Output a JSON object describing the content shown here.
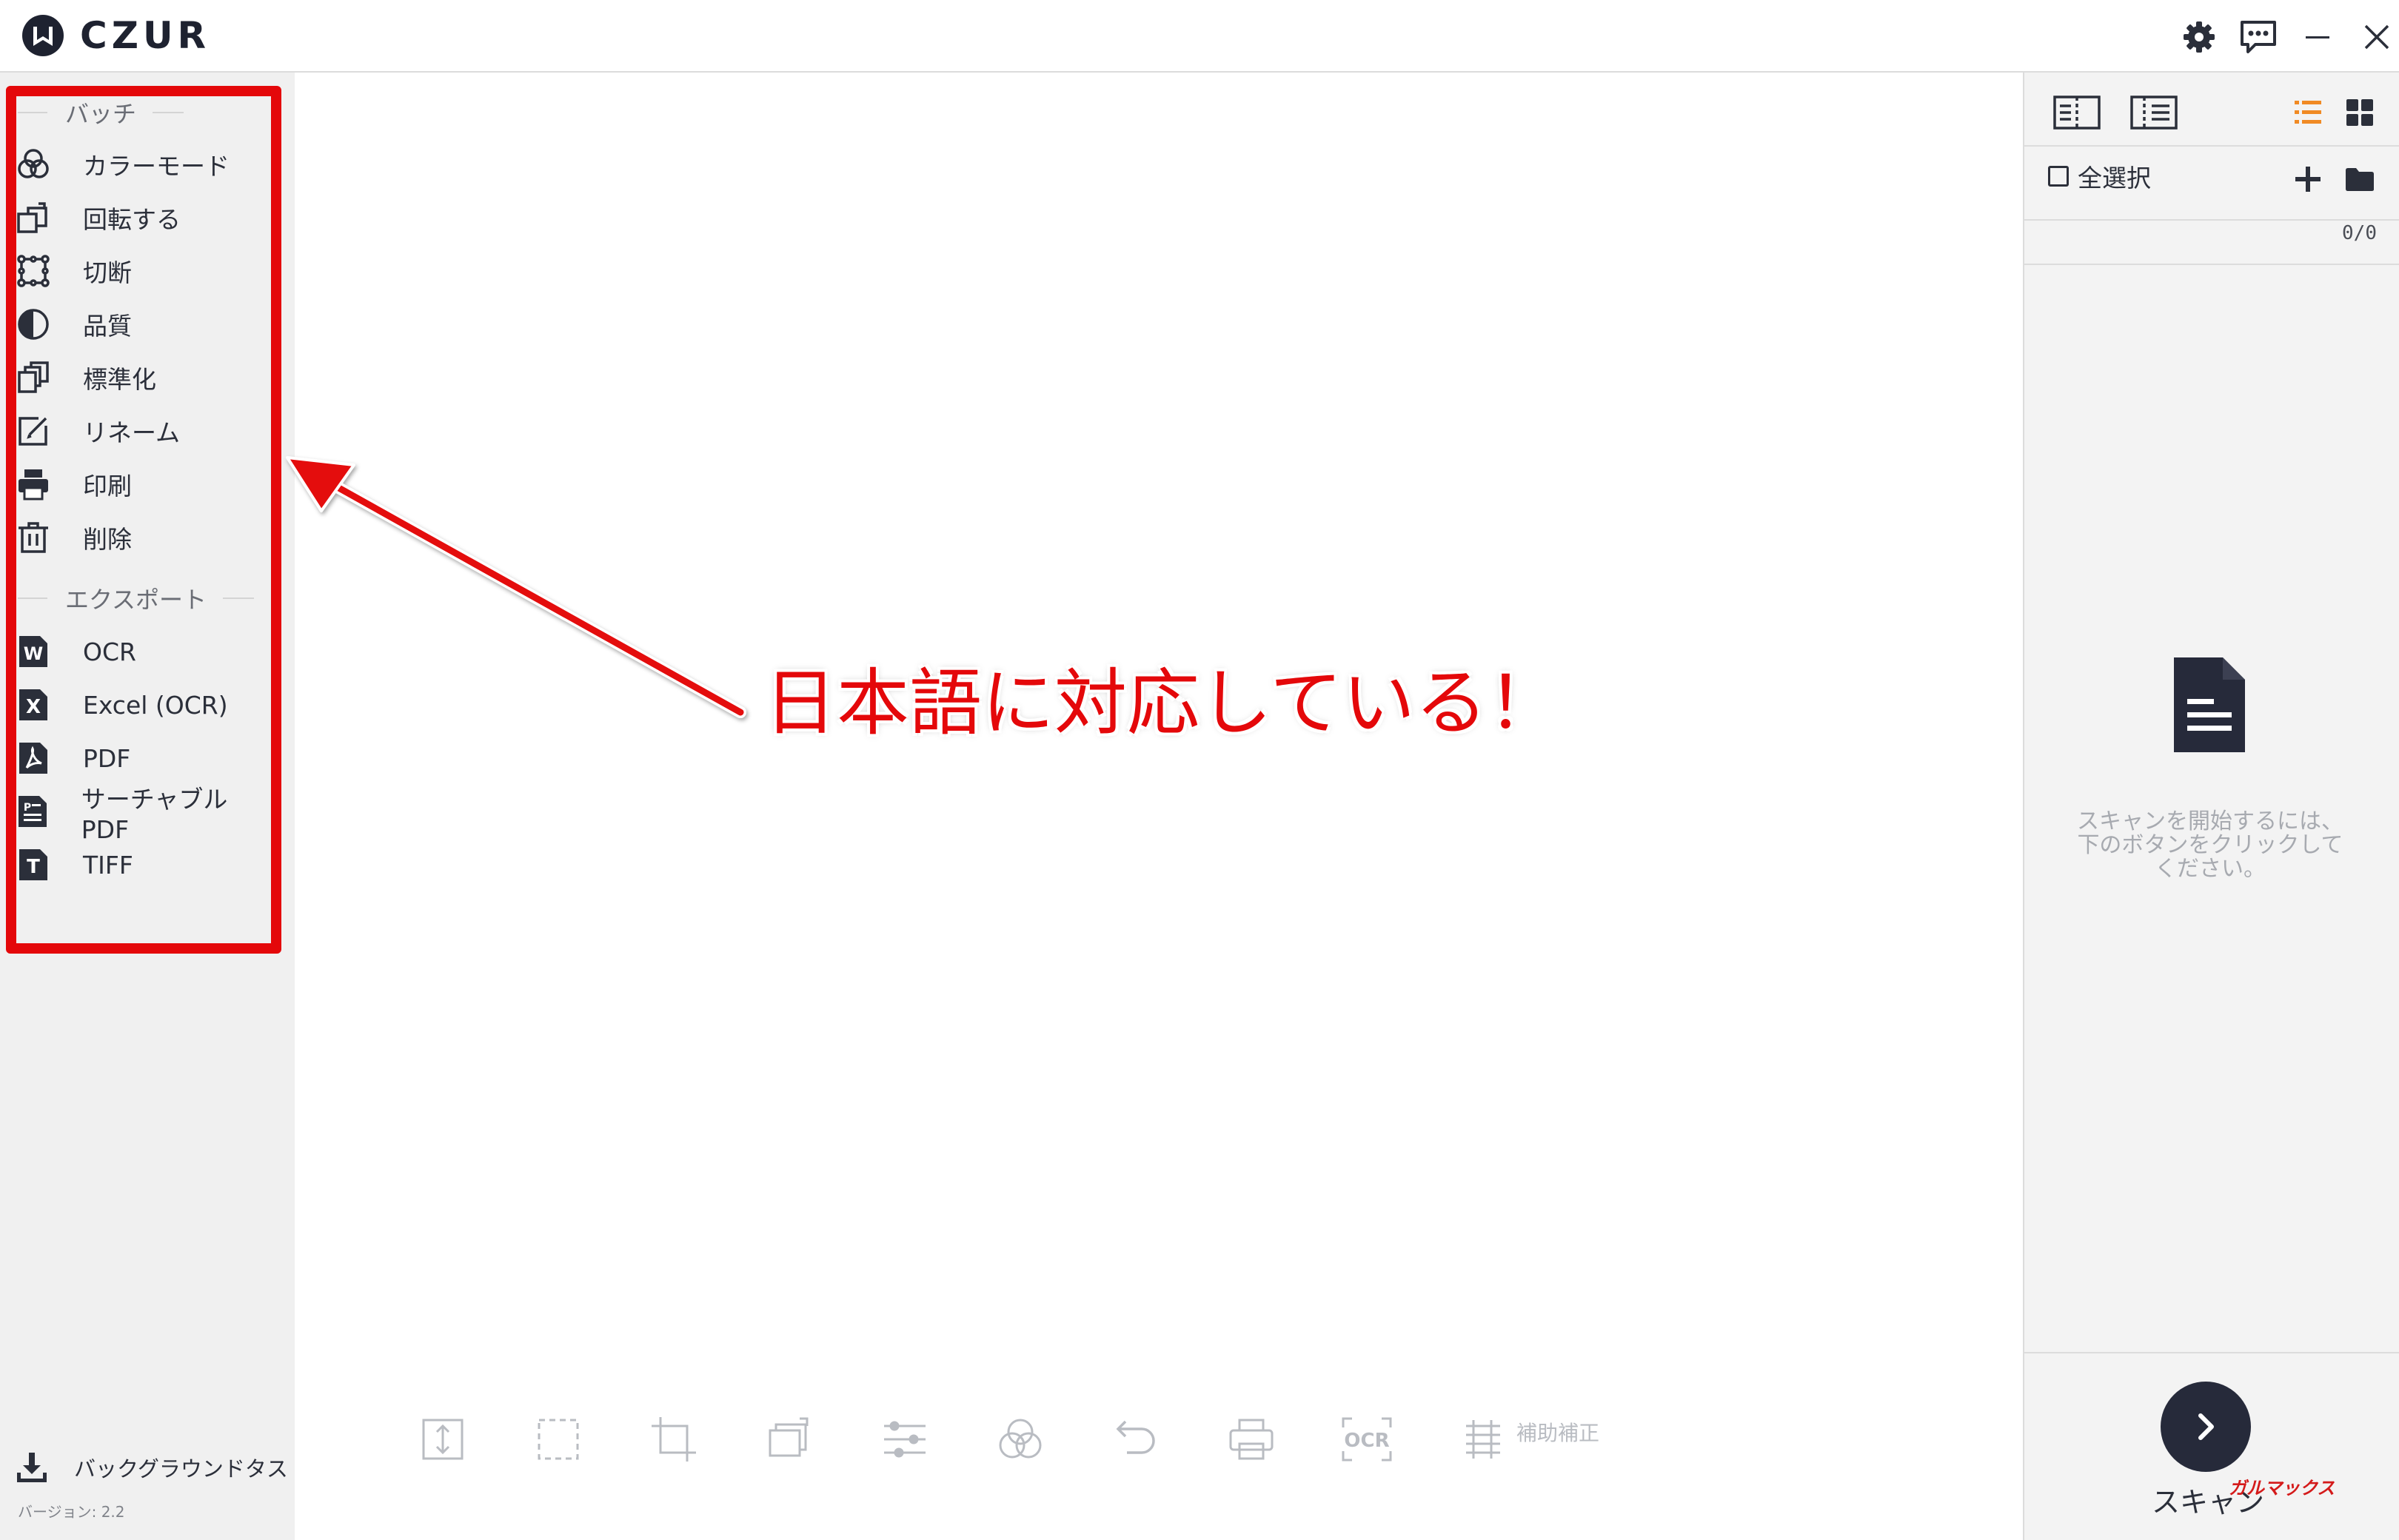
{
  "app": {
    "logo_text": "CZUR"
  },
  "sidebar": {
    "batch_header": "バッチ",
    "batch_items": [
      {
        "label": "カラーモード",
        "icon": "color-mode-icon"
      },
      {
        "label": "回転する",
        "icon": "rotate-icon"
      },
      {
        "label": "切断",
        "icon": "crop-icon"
      },
      {
        "label": "品質",
        "icon": "quality-icon"
      },
      {
        "label": "標準化",
        "icon": "standardize-icon"
      },
      {
        "label": "リネーム",
        "icon": "rename-icon"
      },
      {
        "label": "印刷",
        "icon": "print-icon"
      },
      {
        "label": "削除",
        "icon": "delete-icon"
      }
    ],
    "export_header": "エクスポート",
    "export_items": [
      {
        "label": "OCR",
        "icon": "word-icon"
      },
      {
        "label": "Excel (OCR)",
        "icon": "excel-icon"
      },
      {
        "label": "PDF",
        "icon": "pdf-icon"
      },
      {
        "label": "サーチャブルPDF",
        "icon": "searchable-pdf-icon"
      },
      {
        "label": "TIFF",
        "icon": "tiff-icon"
      }
    ],
    "background_task": "バックグラウンドタスク",
    "version": "バージョン: 2.2"
  },
  "annotation": {
    "text": "日本語に対応している！",
    "color": "#e4080a"
  },
  "toolbar": {
    "aux_label": "補助補正"
  },
  "right_panel": {
    "select_all": "全選択",
    "counter": "0/0",
    "empty_message": "スキャンを開始するには、下のボタンをクリックしてください。",
    "scan_label": "スキャン",
    "watermark": "ガルマックス"
  },
  "colors": {
    "accent_orange": "#f08a24",
    "dark": "#262a3a",
    "highlight_red": "#e4080a"
  }
}
